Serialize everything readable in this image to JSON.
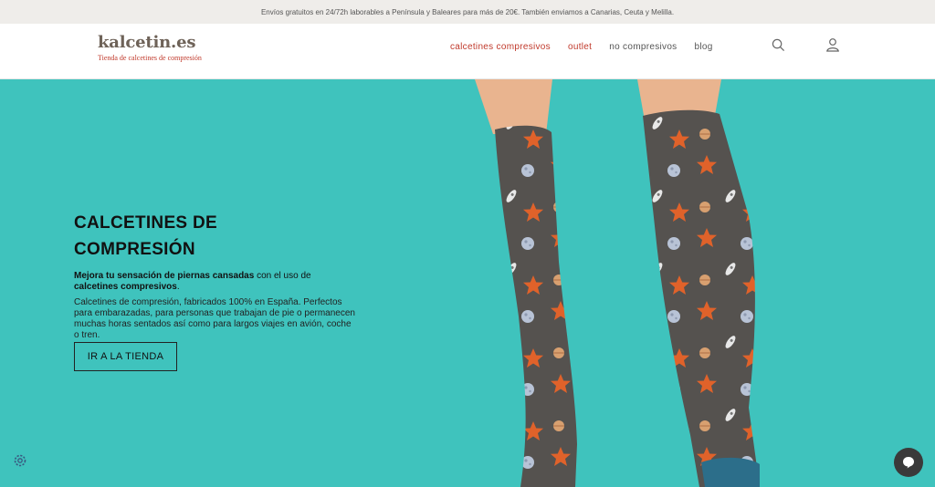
{
  "topbar": {
    "message": "Envíos gratuitos en 24/72h laborables a Península y Baleares para más de 20€. También enviamos a Canarias, Ceuta y Melilla."
  },
  "header": {
    "logo_name": "kalcetin.es",
    "logo_tagline": "Tienda de calcetines de compresión",
    "nav": [
      {
        "label": "calcetines compresivos"
      },
      {
        "label": "outlet"
      },
      {
        "label": "no compresivos"
      },
      {
        "label": "blog"
      }
    ],
    "icons": {
      "search": "search-icon",
      "account": "user-icon"
    }
  },
  "hero": {
    "title": "CALCETINES DE COMPRESIÓN",
    "lead_bold_1": "Mejora tu sensación de piernas cansadas",
    "lead_text": " con el uso de",
    "lead_bold_2": "calcetines compresivos",
    "lead_end": ".",
    "body": "Calcetines de compresión, fabricados 100% en España. Perfectos para embarazadas, para personas que trabajan de pie o permanecen muchas horas sentados así como para largos viajes en avión, coche o tren.",
    "cta_label": "IR A LA TIENDA"
  },
  "colors": {
    "accent": "#c0392b",
    "hero_bg": "#3fc3bd",
    "sock": "#55524f",
    "star": "#e0622a",
    "toe": "#2c6e8a"
  },
  "widgets": {
    "cookie": "gear-icon",
    "chat": "chat-icon"
  }
}
